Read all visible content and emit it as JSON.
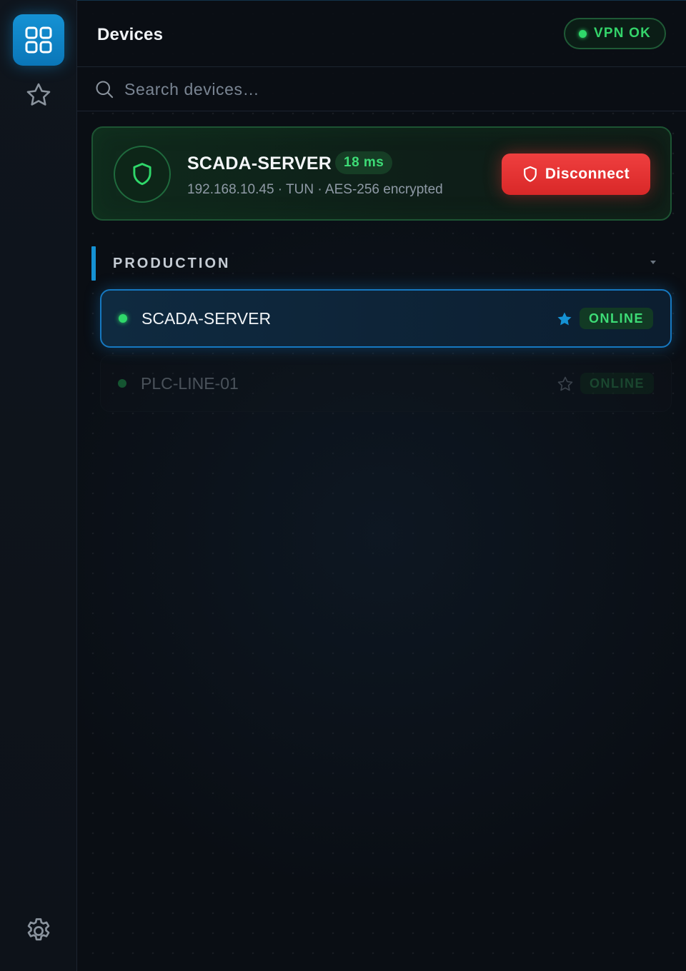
{
  "header": {
    "title": "Devices",
    "vpn_status": "VPN OK"
  },
  "search": {
    "placeholder": "Search devices…",
    "value": ""
  },
  "active_connection": {
    "name": "SCADA-SERVER",
    "latency": "18 ms",
    "meta": "192.168.10.45 · TUN · AES-256 encrypted",
    "disconnect_label": "Disconnect"
  },
  "group": {
    "label": "PRODUCTION",
    "devices": [
      {
        "name": "SCADA-SERVER",
        "status": "ONLINE",
        "favorite": true,
        "selected": true
      },
      {
        "name": "PLC-LINE-01",
        "status": "ONLINE",
        "favorite": false,
        "selected": false
      }
    ]
  },
  "icons": {
    "rail_devices": "grid-icon",
    "rail_favorites": "star-icon",
    "rail_settings": "gear-icon",
    "search": "search-icon",
    "shield": "shield-icon"
  },
  "colors": {
    "accent": "#1592d4",
    "success": "#2fd86a",
    "danger": "#e53535",
    "background": "#0a0e14"
  }
}
